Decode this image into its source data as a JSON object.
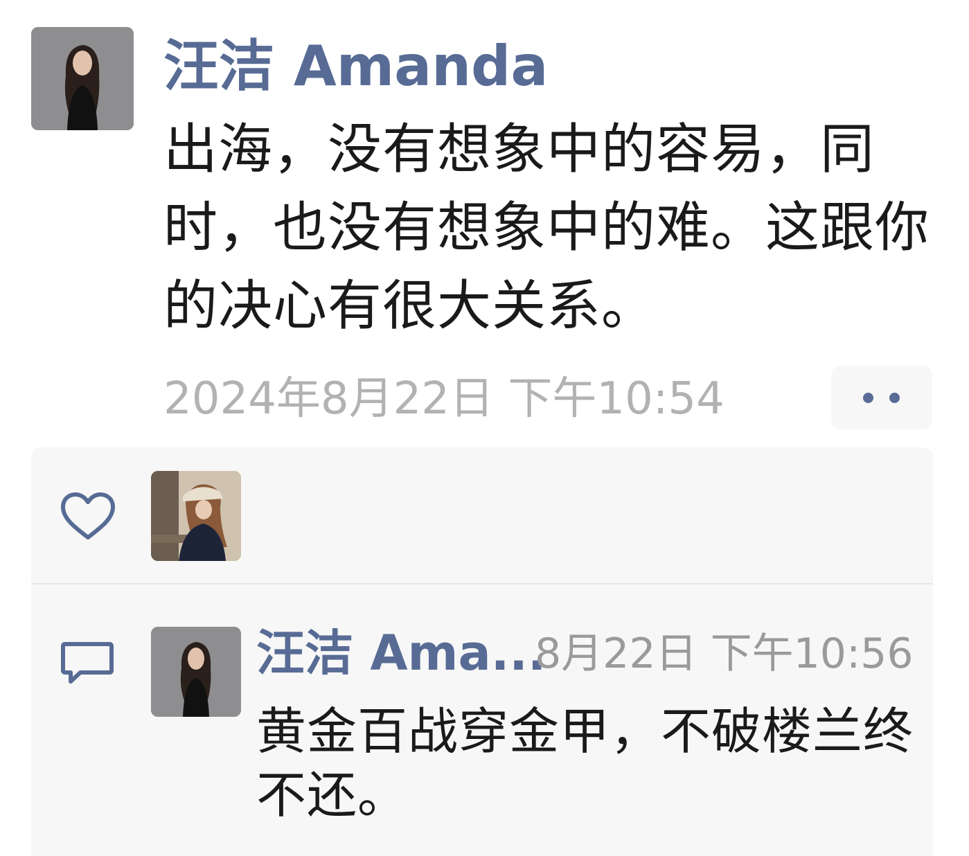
{
  "post": {
    "author_name": "汪洁 Amanda",
    "author_avatar_icon": "person-avatar",
    "text": "出海，没有想象中的容易，同时，也没有想象中的难。这跟你的决心有很大关系。",
    "timestamp": "2024年8月22日 下午10:54",
    "more_icon": "two-dots-icon"
  },
  "likes": {
    "icon": "heart-outline-icon",
    "liker_avatar_icon": "person-avatar"
  },
  "comments": [
    {
      "icon": "comment-bubble-icon",
      "author_avatar_icon": "person-avatar",
      "author_name": "汪洁 Ama...",
      "time": "8月22日 下午10:56",
      "text": "黄金百战穿金甲，不破楼兰终不还。"
    }
  ],
  "colors": {
    "link_blue": "#576b95",
    "timestamp_gray": "#b2b2b2",
    "panel_bg": "#f7f7f7",
    "text_black": "#1a1a1a"
  }
}
